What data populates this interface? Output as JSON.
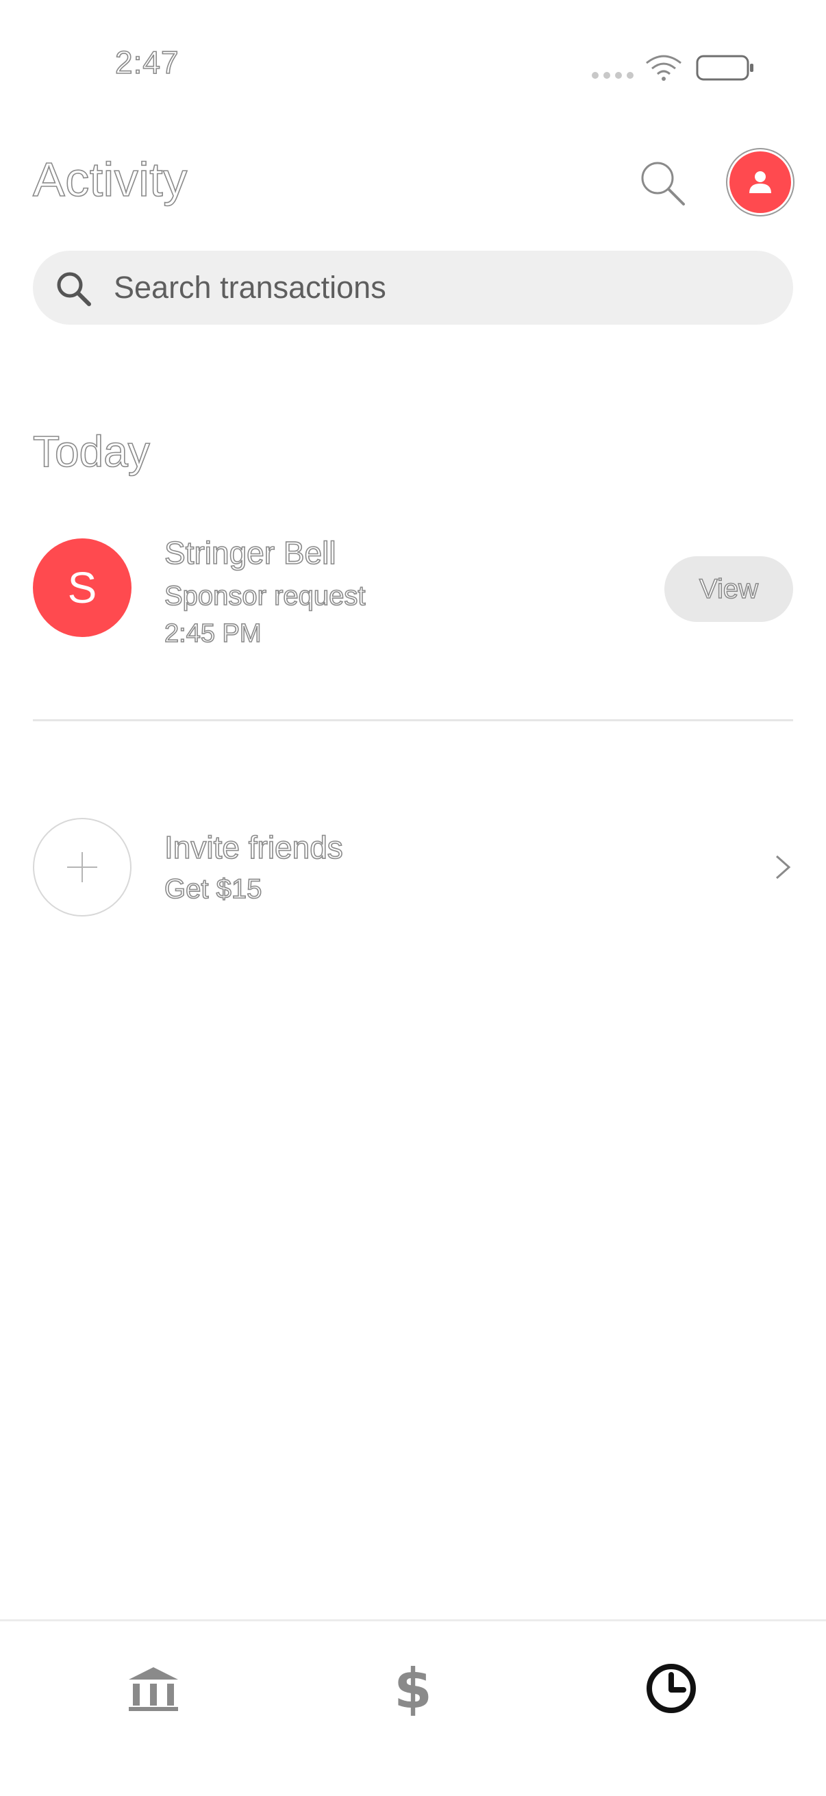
{
  "status_bar": {
    "time": "2:47",
    "icons": [
      "signal-dots-icon",
      "wifi-icon",
      "battery-icon"
    ]
  },
  "header": {
    "title": "Activity",
    "search_icon": "search-icon",
    "profile_icon": "person-icon"
  },
  "search": {
    "placeholder": "Search transactions",
    "value": ""
  },
  "sections": {
    "today": {
      "heading": "Today",
      "items": [
        {
          "avatar_letter": "S",
          "name": "Stringer Bell",
          "subtitle": "Sponsor request",
          "time": "2:45 PM",
          "action_label": "View"
        }
      ]
    }
  },
  "invite": {
    "title": "Invite friends",
    "subtitle": "Get $15"
  },
  "bottom_nav": {
    "items": [
      {
        "icon": "bank-icon",
        "active": false
      },
      {
        "icon": "dollar-icon",
        "active": false
      },
      {
        "icon": "clock-icon",
        "active": true
      }
    ]
  },
  "colors": {
    "accent": "#ff4a4f",
    "search_bg": "#efefef",
    "button_bg": "#e8e8e8",
    "divider": "#e6e6e6",
    "nav_inactive": "#8a8a8a",
    "nav_active": "#111111"
  }
}
